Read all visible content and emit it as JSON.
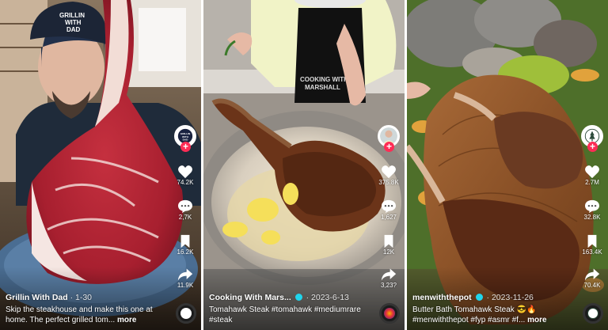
{
  "panels": [
    {
      "author": "Grillin With Dad",
      "date": "1-30",
      "description": "Skip the steakhouse and make this one at home. The perfect grilled tom...",
      "more": "more",
      "likes": "74.2K",
      "comments": "2,7K",
      "saves": "16.2K",
      "shares": "11.9K",
      "hat_text_line1": "GRILLIN",
      "hat_text_line2": "WITH",
      "hat_text_line3": "DAD",
      "avatar_line1": "GRILLIN",
      "avatar_line2": "WITH",
      "avatar_line3": "DAD"
    },
    {
      "author": "Cooking With Mars...",
      "date": "2023-6-13",
      "description": "Tomahawk Steak #tomahawk #mediumrare #steak",
      "more": "",
      "likes": "375.8K",
      "comments": "1,627",
      "saves": "12K",
      "shares": "3,23?",
      "apron_text_line1": "COOKING WITH",
      "apron_text_line2": "MARSHALL"
    },
    {
      "author": "menwiththepot",
      "date": "2023-11-26",
      "description": "Butter Bath Tomahawk Steak 😎🔥 #menwiththepot #fyp #asmr #f...",
      "more": "more",
      "likes": "2.7M",
      "comments": "32.8K",
      "saves": "163.4K",
      "shares": "70.4K"
    }
  ],
  "icons": {
    "like": "heart-icon",
    "comment": "comment-icon",
    "save": "bookmark-icon",
    "share": "share-arrow-icon",
    "follow": "plus-icon",
    "music": "music-disc-icon"
  },
  "follow_glyph": "+",
  "colors": {
    "follow": "#fe2c55",
    "verified": "#20d5ec",
    "text": "#ffffff"
  }
}
